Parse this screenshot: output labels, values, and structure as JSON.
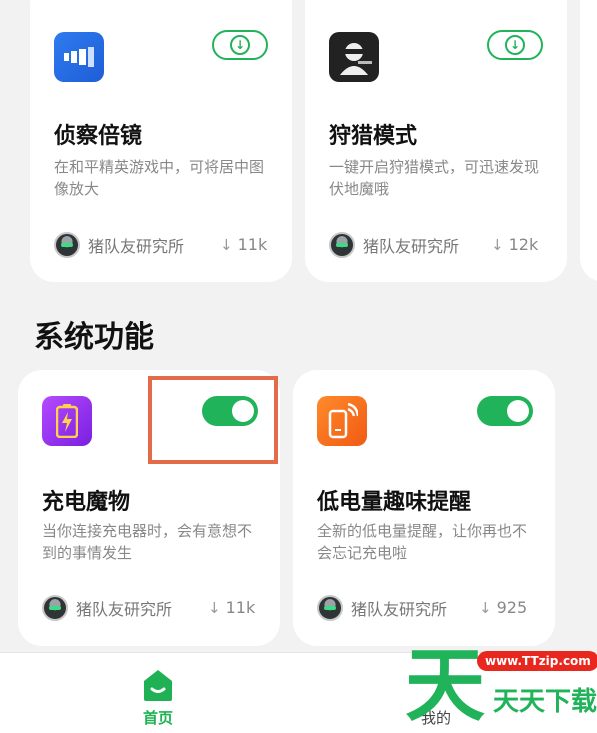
{
  "cards_top": [
    {
      "title": "侦察倍镜",
      "desc": "在和平精英游戏中，可将居中图像放大",
      "author": "猪队友研究所",
      "downloads": "11k",
      "action": "download",
      "icon": "scope-icon"
    },
    {
      "title": "狩猎模式",
      "desc": "一键开启狩猎模式，可迅速发现伏地魔哦",
      "author": "猪队友研究所",
      "downloads": "12k",
      "action": "download",
      "icon": "hunter-icon"
    }
  ],
  "section": {
    "title": "系统功能"
  },
  "cards_system": [
    {
      "title": "充电魔物",
      "desc": "当你连接充电器时，会有意想不到的事情发生",
      "author": "猪队友研究所",
      "downloads": "11k",
      "toggle": "on",
      "icon": "battery-charging-icon"
    },
    {
      "title": "低电量趣味提醒",
      "desc": "全新的低电量提醒，让你再也不会忘记充电啦",
      "author": "猪队友研究所",
      "downloads": "925",
      "toggle": "on",
      "icon": "phone-signal-icon"
    }
  ],
  "nav": {
    "home": "首页",
    "mine": "我的"
  },
  "watermark": {
    "url": "www.TTzip.com",
    "brand": "天天下载",
    "logo": "天"
  },
  "colors": {
    "accent": "#21b35a",
    "highlight": "#e36b4a"
  }
}
